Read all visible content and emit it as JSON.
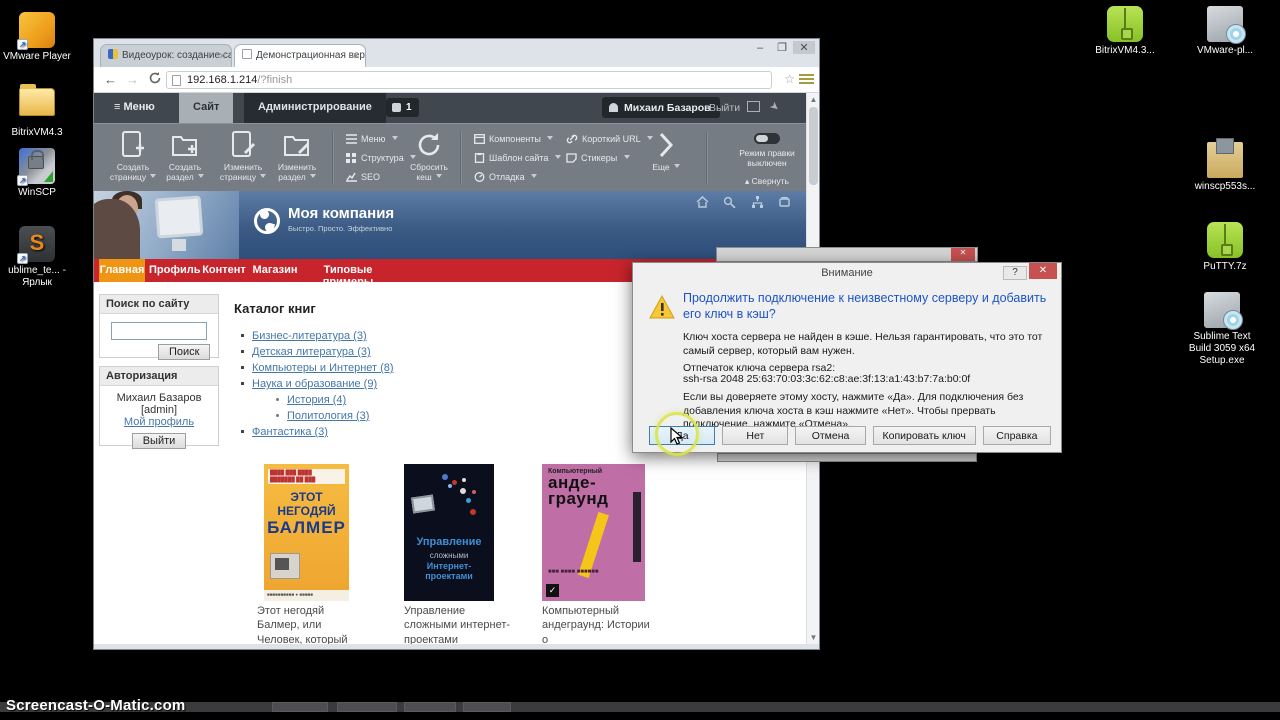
{
  "colors": {
    "accent_red": "#c8242b",
    "active_orange": "#ef9413",
    "admin_dark": "#40474e",
    "toolbar_gray": "#757c83",
    "link_blue": "#4477aa",
    "dialog_heading_blue": "#1d55c8",
    "highlight_yellow": "#d8e44a"
  },
  "desktop": {
    "left_icons": [
      {
        "icon": "vmware-player",
        "label": "VMware Player"
      },
      {
        "icon": "folder",
        "label": "BitrixVM4.3"
      },
      {
        "icon": "winscp",
        "label": "WinSCP"
      },
      {
        "icon": "sublime-shortcut",
        "label": "ublime_te... - Ярлык"
      }
    ],
    "right_icons": [
      {
        "icon": "7zip-archive",
        "label": "BitrixVM4.3..."
      },
      {
        "icon": "installer",
        "label": "VMware-pl..."
      },
      {
        "icon": "installer-box",
        "label": "winscp553s..."
      },
      {
        "icon": "7zip-archive",
        "label": "PuTTY.7z"
      },
      {
        "icon": "installer",
        "label": "Sublime Text Build 3059 x64 Setup.exe"
      }
    ]
  },
  "browser": {
    "tabs": [
      {
        "title": "Видеоурок: создание са",
        "close": "✕"
      },
      {
        "title": "Демонстрационная вер",
        "close": "✕"
      }
    ],
    "url_host": "192.168.1.214",
    "url_path": "/?finish",
    "controls": {
      "minimize": "–",
      "maximize": "❐",
      "close": "✕"
    },
    "back": "←",
    "forward": "→"
  },
  "admin_bar": {
    "menu": "Меню",
    "tab_site": "Сайт",
    "tab_admin": "Администрирование",
    "notifications": "1",
    "user": "Михаил Базаров",
    "logout": "Выйти"
  },
  "toolbar": {
    "big": [
      {
        "icon": "page-add",
        "label": "Создать страницу"
      },
      {
        "icon": "folder-add",
        "label": "Создать раздел"
      },
      {
        "icon": "page-edit",
        "label": "Изменить страницу"
      },
      {
        "icon": "folder-edit",
        "label": "Изменить раздел"
      }
    ],
    "menu_group": [
      {
        "icon": "menu-list",
        "label": "Меню"
      },
      {
        "icon": "structure-grid",
        "label": "Структура"
      },
      {
        "icon": "seo-chart",
        "label": "SEO"
      }
    ],
    "reset_cache": {
      "icon": "refresh",
      "label": "Сбросить кеш"
    },
    "comp_group": [
      {
        "icon": "components",
        "label": "Компоненты"
      },
      {
        "icon": "site-template",
        "label": "Шаблон сайта"
      },
      {
        "icon": "debug",
        "label": "Отладка"
      }
    ],
    "url_group": [
      {
        "icon": "short-url",
        "label": "Короткий URL"
      },
      {
        "icon": "stickers",
        "label": "Стикеры"
      }
    ],
    "more": {
      "icon": "chevron-right",
      "label": "Еще"
    },
    "edit_mode_label": "Режим правки",
    "edit_mode_state": "выключен",
    "collapse": "Свернуть"
  },
  "site": {
    "logo": "Моя компания",
    "tagline": "Быстро. Просто. Эффективно",
    "nav": [
      {
        "label": "Главная",
        "active": true
      },
      {
        "label": "Профиль",
        "active": false
      },
      {
        "label": "Контент",
        "active": false
      },
      {
        "label": "Магазин",
        "active": false
      },
      {
        "label": "Типовые примеры",
        "active": false
      }
    ],
    "search": {
      "title": "Поиск по сайту",
      "button": "Поиск"
    },
    "auth": {
      "title": "Авторизация",
      "user": "Михаил Базаров",
      "role": "[admin]",
      "profile_link": "Мой профиль",
      "logout_button": "Выйти"
    },
    "catalog_title": "Каталог книг",
    "catalog": [
      {
        "label": "Бизнес-литература (3)",
        "level": 1
      },
      {
        "label": "Детская литература (3)",
        "level": 1
      },
      {
        "label": "Компьютеры и Интернет (8)",
        "level": 1
      },
      {
        "label": "Наука и образование (9)",
        "level": 1
      },
      {
        "label": "История (4)",
        "level": 2
      },
      {
        "label": "Политология (3)",
        "level": 2
      },
      {
        "label": "Фантастика (3)",
        "level": 1
      }
    ],
    "books": [
      {
        "cover_line1": "ЭТОТ НЕГОДЯЙ",
        "cover_line2": "БАЛМЕР",
        "caption": "Этот негодяй Балмер, или Человек, который"
      },
      {
        "cover_line1": "Управление",
        "cover_line2": "сложными",
        "cover_line3": "Интернет-проектами",
        "caption": "Управление сложными интернет-проектами"
      },
      {
        "cover_line0": "Компьютерный",
        "cover_line1": "анде-",
        "cover_line2": "граунд",
        "caption": "Компьютерный андеграунд: Истории о"
      }
    ]
  },
  "dialog": {
    "title": "Внимание",
    "help": "?",
    "close": "✕",
    "heading": "Продолжить подключение к неизвестному серверу и добавить его ключ в кэш?",
    "body1": "Ключ хоста сервера не найден в кэше. Нельзя гарантировать, что это тот самый сервер, который вам нужен.",
    "fingerprint_label": "Отпечаток ключа сервера rsa2:",
    "fingerprint": "ssh-rsa 2048 25:63:70:03:3c:62:c8:ae:3f:13:a1:43:b7:7a:b0:0f",
    "body2": "Если вы доверяете этому хосту, нажмите «Да». Для подключения без добавления ключа хоста в кэш нажмите «Нет». Чтобы прервать подключение, нажмите «Отмена».",
    "buttons": [
      "Да",
      "Нет",
      "Отмена",
      "Копировать ключ",
      "Справка"
    ]
  },
  "taskbar": {
    "watermark": "Screencast-O-Matic.com"
  }
}
